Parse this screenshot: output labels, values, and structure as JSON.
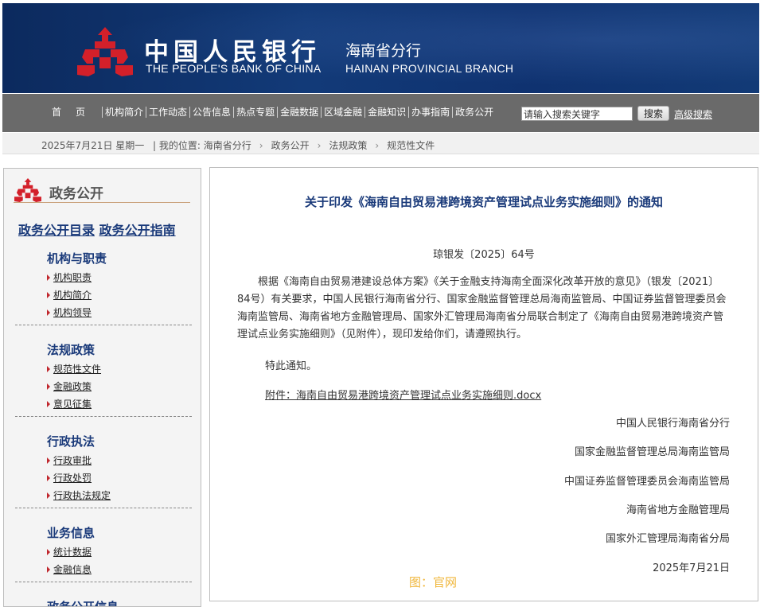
{
  "header": {
    "bank_name_cn": "中国人民银行",
    "branch_name_cn": "海南省分行",
    "bank_name_en": "THE PEOPLE'S BANK OF CHINA",
    "branch_name_en": "HAINAN PROVINCIAL BRANCH",
    "colors": {
      "banner": "#123a78",
      "nav": "#6a6a6a",
      "accent_red": "#c0272d"
    }
  },
  "nav": {
    "items": [
      "首页",
      "机构简介",
      "工作动态",
      "公告信息",
      "热点专题",
      "金融数据",
      "区域金融",
      "金融知识",
      "办事指南",
      "政务公开"
    ],
    "search_placeholder": "请输入搜索关键字",
    "search_button": "搜索",
    "advanced_search": "高级搜索"
  },
  "crumbbar": {
    "date": "2025年7月21日 星期一",
    "location_label": "| 我的位置:",
    "crumbs": [
      "海南省分行",
      "政务公开",
      "法规政策",
      "规范性文件"
    ]
  },
  "sidebar": {
    "title": "政务公开",
    "link_catalog": "政务公开目录",
    "link_guide": "政务公开指南",
    "groups": [
      {
        "title": "机构与职责",
        "items": [
          "机构职责",
          "机构简介",
          "机构领导"
        ]
      },
      {
        "title": "法规政策",
        "items": [
          "规范性文件",
          "金融政策",
          "意见征集"
        ]
      },
      {
        "title": "行政执法",
        "items": [
          "行政审批",
          "行政处罚",
          "行政执法规定"
        ]
      },
      {
        "title": "业务信息",
        "items": [
          "统计数据",
          "金融信息"
        ]
      },
      {
        "title": "政务公开信息",
        "items": []
      }
    ]
  },
  "article": {
    "title": "关于印发《海南自由贸易港跨境资产管理试点业务实施细则》的通知",
    "doc_number": "琼银发〔2025〕64号",
    "body": "根据《海南自由贸易港建设总体方案》《关于金融支持海南全面深化改革开放的意见》（银发〔2021〕84号）有关要求，中国人民银行海南省分行、国家金融监督管理总局海南监管局、中国证券监督管理委员会海南监管局、海南省地方金融管理局、国家外汇管理局海南省分局联合制定了《海南自由贸易港跨境资产管理试点业务实施细则》（见附件），现印发给你们，请遵照执行。",
    "notice": "特此通知。",
    "attachment": "附件：海南自由贸易港跨境资产管理试点业务实施细则.docx",
    "signatories": [
      "中国人民银行海南省分行",
      "国家金融监督管理总局海南监管局",
      "中国证券监督管理委员会海南监管局",
      "海南省地方金融管理局",
      "国家外汇管理局海南省分局"
    ],
    "date": "2025年7月21日",
    "image_credit": "图：官网"
  }
}
